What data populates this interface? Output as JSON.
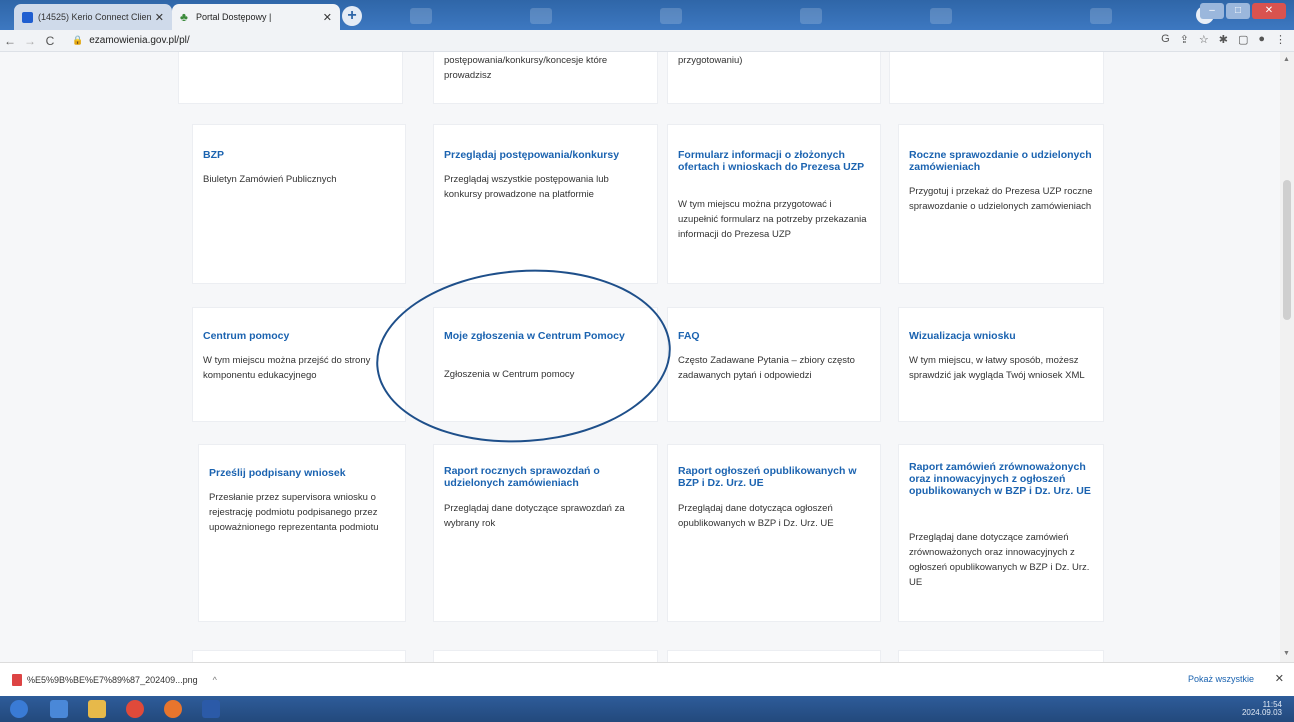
{
  "browser": {
    "tabs": [
      {
        "label": "(14525) Kerio Connect Client - h"
      },
      {
        "label": "Portal Dostępowy |"
      }
    ],
    "url": "ezamowienia.gov.pl/pl/"
  },
  "cards": [
    {
      "title": "",
      "desc": "postępowania/konkursy/koncesje które prowadzisz"
    },
    {
      "title": "",
      "desc": "przygotowaniu)"
    },
    {
      "title": "BZP",
      "desc": "Biuletyn Zamówień Publicznych"
    },
    {
      "title": "Przeglądaj postępowania/konkursy",
      "desc": "Przeglądaj wszystkie postępowania lub konkursy prowadzone na platformie"
    },
    {
      "title": "Formularz informacji o złożonych ofertach i wnioskach do Prezesa UZP",
      "desc": "W tym miejscu można przygotować i uzupełnić formularz na potrzeby przekazania informacji do Prezesa UZP"
    },
    {
      "title": "Roczne sprawozdanie o udzielonych zamówieniach",
      "desc": "Przygotuj i przekaż do Prezesa UZP roczne sprawozdanie o udzielonych zamówieniach"
    },
    {
      "title": "Centrum pomocy",
      "desc": "W tym miejscu można przejść do strony komponentu edukacyjnego"
    },
    {
      "title": "Moje zgłoszenia w Centrum Pomocy",
      "desc": "Zgłoszenia w Centrum pomocy"
    },
    {
      "title": "FAQ",
      "desc": "Często Zadawane Pytania – zbiory często zadawanych pytań i odpowiedzi"
    },
    {
      "title": "Wizualizacja wniosku",
      "desc": "W tym miejscu, w łatwy sposób, możesz sprawdzić jak wygląda Twój wniosek XML"
    },
    {
      "title": "Prześlij podpisany wniosek",
      "desc": "Przesłanie przez supervisora wniosku o rejestrację podmiotu podpisanego przez upoważnionego reprezentanta podmiotu"
    },
    {
      "title": "Raport rocznych sprawozdań o udzielonych zamówieniach",
      "desc": "Przeglądaj dane dotyczące sprawozdań za wybrany rok"
    },
    {
      "title": "Raport ogłoszeń opublikowanych w BZP i Dz. Urz. UE",
      "desc": "Przeglądaj dane dotycząca ogłoszeń opublikowanych w BZP i Dz. Urz. UE"
    },
    {
      "title": "Raport zamówień zrównoważonych oraz innowacyjnych z ogłoszeń opublikowanych w BZP i Dz. Urz. UE",
      "desc": "Przeglądaj dane dotyczące zamówień zrównoważonych oraz innowacyjnych z ogłoszeń opublikowanych w BZP i Dz. Urz. UE"
    }
  ],
  "download_bar": {
    "file": "%E5%9B%BE%E7%89%87_202409...png",
    "show_all": "Pokaż wszystkie"
  },
  "taskbar": {
    "time": "11:54",
    "date": "2024.09.03"
  },
  "colors": {
    "link": "#1b63b0",
    "annotation_circle": "#1e4f8a"
  }
}
